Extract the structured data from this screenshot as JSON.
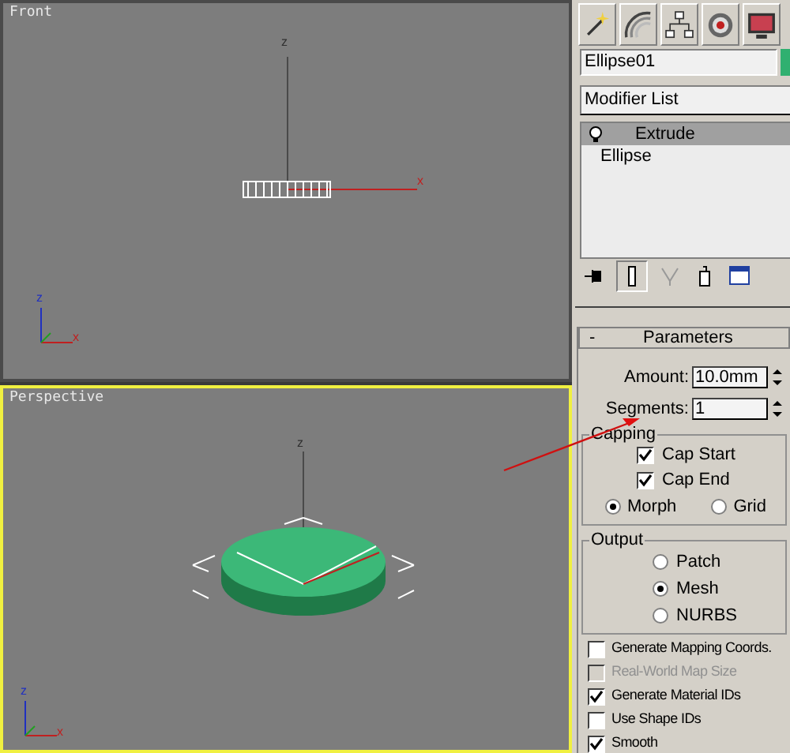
{
  "viewports": [
    {
      "label": "Front",
      "active": false,
      "gizmo_labels": [
        "z",
        "x"
      ],
      "tripod_labels": [
        "z",
        "x"
      ]
    },
    {
      "label": "Perspective",
      "active": true,
      "gizmo_labels": [
        "z"
      ],
      "tripod_labels": [
        "z",
        "x"
      ]
    }
  ],
  "command_panel": {
    "object_name": "Ellipse01",
    "modifier_list": "Modifier List",
    "stack": [
      {
        "label": "Extrude",
        "selected": true
      },
      {
        "label": "Ellipse",
        "selected": false
      }
    ],
    "rollout": {
      "toggle": "-",
      "title": "Parameters",
      "spinners": [
        {
          "label": "Amount:",
          "value": "10.0mm"
        },
        {
          "label": "Segments:",
          "value": "1"
        }
      ],
      "groups": [
        {
          "title": "Capping",
          "items": [
            {
              "kind": "checkbox",
              "label": "Cap Start",
              "checked": true,
              "disabled": false
            },
            {
              "kind": "checkbox",
              "label": "Cap End",
              "checked": true,
              "disabled": false
            },
            {
              "kind": "radio-pair",
              "options": [
                {
                  "label": "Morph",
                  "selected": true
                },
                {
                  "label": "Grid",
                  "selected": false
                }
              ]
            }
          ]
        },
        {
          "title": "Output",
          "items": [
            {
              "kind": "radio",
              "label": "Patch",
              "selected": false
            },
            {
              "kind": "radio",
              "label": "Mesh",
              "selected": true
            },
            {
              "kind": "radio",
              "label": "NURBS",
              "selected": false
            }
          ]
        }
      ],
      "options": [
        {
          "label": "Generate Mapping Coords.",
          "checked": false,
          "disabled": false
        },
        {
          "label": "Real-World Map Size",
          "checked": false,
          "disabled": true
        },
        {
          "label": "Generate Material IDs",
          "checked": true,
          "disabled": false
        },
        {
          "label": "Use Shape IDs",
          "checked": false,
          "disabled": false
        },
        {
          "label": "Smooth",
          "checked": true,
          "disabled": false
        }
      ]
    }
  }
}
